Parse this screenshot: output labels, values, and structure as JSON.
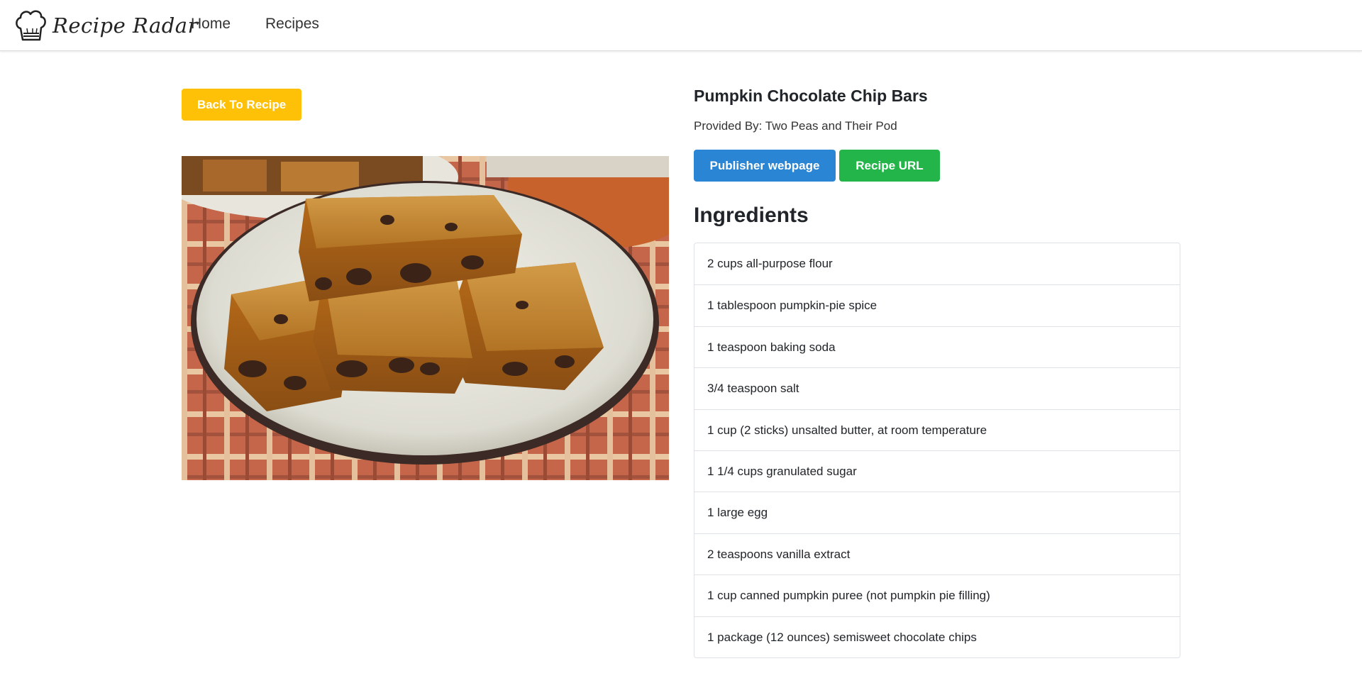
{
  "brand": {
    "name": "Recipe Radar",
    "icon": "chef-hat-icon"
  },
  "nav": {
    "items": [
      {
        "label": "Home"
      },
      {
        "label": "Recipes"
      }
    ]
  },
  "back_button": {
    "label": "Back To Recipe",
    "color": "#ffc107"
  },
  "recipe": {
    "title": "Pumpkin Chocolate Chip Bars",
    "provided_by": "Provided By: Two Peas and Their Pod",
    "publisher_button": {
      "label": "Publisher webpage",
      "color": "#2a85d4"
    },
    "url_button": {
      "label": "Recipe URL",
      "color": "#23b44a"
    },
    "image_alt": "pumpkin-chocolate-chip-bars-photo"
  },
  "ingredients": {
    "heading": "Ingredients",
    "items": [
      "2 cups all-purpose flour",
      "1 tablespoon pumpkin-pie spice",
      "1 teaspoon baking soda",
      "3/4 teaspoon salt",
      "1 cup (2 sticks) unsalted butter, at room temperature",
      "1 1/4 cups granulated sugar",
      "1 large egg",
      "2 teaspoons vanilla extract",
      "1 cup canned pumpkin puree (not pumpkin pie filling)",
      "1 package (12 ounces) semisweet chocolate chips"
    ]
  }
}
